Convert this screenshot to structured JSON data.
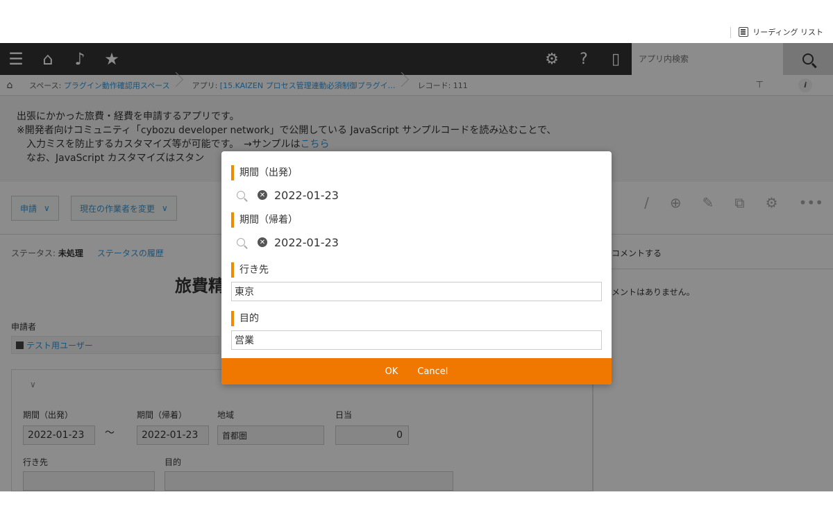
{
  "browser": {
    "reading_list": "リーディング リスト"
  },
  "header": {
    "search_placeholder": "アプリ内検索",
    "icons": [
      "menu-icon",
      "home-icon",
      "bell-icon",
      "star-icon",
      "gear-icon",
      "help-icon",
      "mobile-icon",
      "search-icon"
    ]
  },
  "breadcrumb": {
    "space_prefix": "スペース: ",
    "space": "プラグイン動作確認用スペース",
    "app_prefix": "アプリ: ",
    "app": "[15.KAIZEN プロセス管理連動必須制御プラグイ…",
    "record": "レコード: 111"
  },
  "description": {
    "line1": "出張にかかった旅費・経費を申請するアプリです。",
    "line2": "※開発者向けコミュニティ「cybozu developer network」で公開している JavaScript サンプルコードを読み込むことで、",
    "line3a": "入力ミスを防止するカスタマイズ等が可能です。　→サンプルは",
    "line3_link": "こちら",
    "line4": "なお、JavaScript カスタマイズはスタン"
  },
  "toolbar": {
    "apply": "申請",
    "change_assignee": "現在の作業者を変更"
  },
  "status": {
    "label": "ステータス: ",
    "value": "未処理",
    "history": "ステータスの履歴"
  },
  "record": {
    "title": "旅費精",
    "applicant_label": "申請者",
    "applicant": "テスト用ユーザー",
    "fields": {
      "depart_label": "期間（出発）",
      "depart_value": "2022-01-23",
      "tilde": "～",
      "return_label": "期間（帰着）",
      "return_value": "2022-01-23",
      "region_label": "地域",
      "region_value": "首都圏",
      "allowance_label": "日当",
      "allowance_value": "0",
      "dest_label": "行き先",
      "purpose_label": "目的"
    }
  },
  "comments": {
    "post": "コメントする",
    "none": "メントはありません。"
  },
  "dialog": {
    "depart_label": "期間（出発）",
    "depart_value": "2022-01-23",
    "return_label": "期間（帰着）",
    "return_value": "2022-01-23",
    "dest_label": "行き先",
    "dest_value": "東京",
    "purpose_label": "目的",
    "purpose_value": "営業",
    "ok": "OK",
    "cancel": "Cancel",
    "accent": "#f07800"
  }
}
